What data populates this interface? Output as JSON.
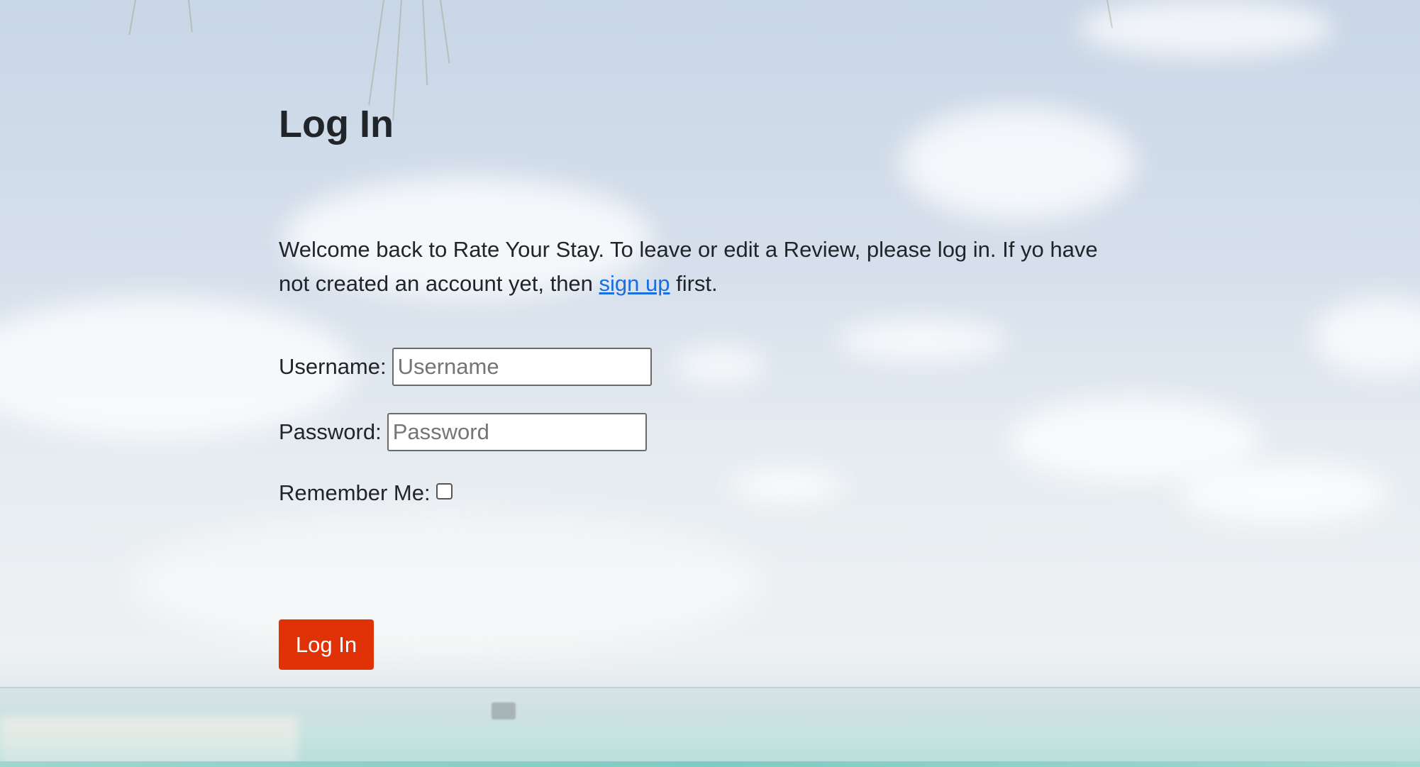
{
  "page": {
    "title": "Log In"
  },
  "intro": {
    "text_before_link": "Welcome back to Rate Your Stay. To leave or edit a Review, please log in. If yo have not created an account yet, then ",
    "link_text": "sign up",
    "text_after_link": " first."
  },
  "form": {
    "username_label": "Username:",
    "username_placeholder": "Username",
    "username_value": "",
    "password_label": "Password:",
    "password_placeholder": "Password",
    "password_value": "",
    "remember_label": "Remember Me:",
    "remember_checked": false,
    "submit_label": "Log In"
  },
  "colors": {
    "button_bg": "#e03206",
    "link": "#1a6fe0",
    "text": "#212529"
  }
}
